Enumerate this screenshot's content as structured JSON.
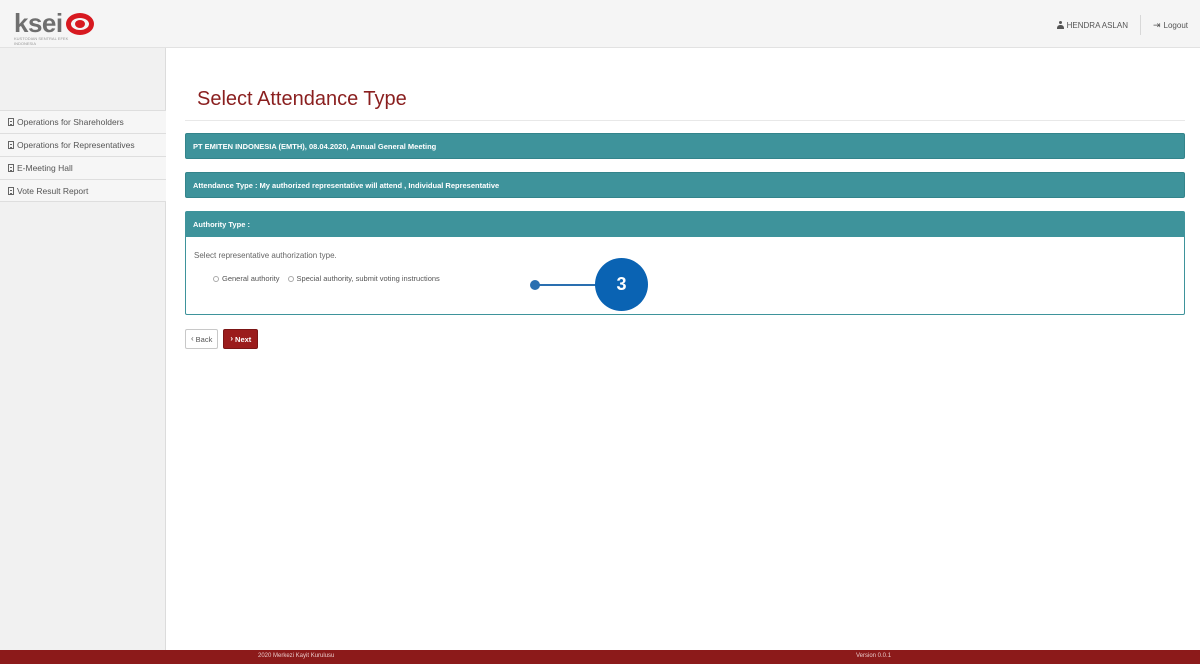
{
  "header": {
    "logo_text": "ksei",
    "logo_subtitle": "KUSTODIAN SENTRAL EFEK INDONESIA",
    "user_name": "HENDRA ASLAN",
    "logout_label": "Logout"
  },
  "sidebar": {
    "items": [
      {
        "label": "Operations for Shareholders"
      },
      {
        "label": "Operations for Representatives"
      },
      {
        "label": "E-Meeting Hall"
      },
      {
        "label": "Vote Result Report"
      }
    ]
  },
  "main": {
    "title": "Select Attendance Type",
    "meeting_bar": "PT EMITEN INDONESIA (EMTH), 08.04.2020, Annual General Meeting",
    "attendance_bar": "Attendance Type : My authorized representative will attend , Individual Representative",
    "authority": {
      "heading": "Authority Type :",
      "instruction": "Select representative authorization type.",
      "options": [
        "General authority",
        "Special authority, submit voting instructions"
      ]
    },
    "callout_number": "3",
    "back_label": "Back",
    "next_label": "Next"
  },
  "footer": {
    "copyright": "2020 Merkezi Kayit Kurulusu",
    "version": "Version 0.0.1"
  },
  "colors": {
    "teal": "#3e939b",
    "brand_red": "#8c1a1a",
    "callout_blue": "#0a63b3",
    "title_red": "#8a1f1f"
  }
}
